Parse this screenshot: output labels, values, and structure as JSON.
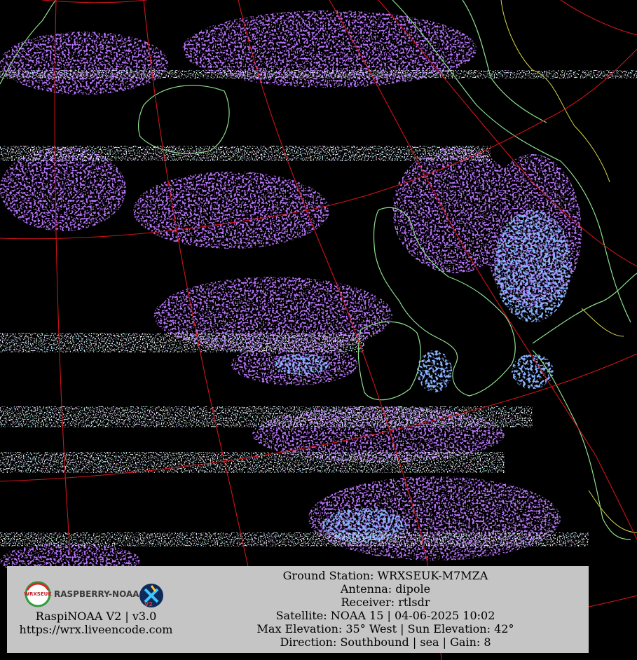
{
  "colors": {
    "background": "#000000",
    "cloud_primary": "#7a2ff0",
    "cloud_bright": "#3b74ff",
    "cloud_light": "#5fa8ff",
    "grid_line": "#d0141a",
    "coastline": "#8fe08f",
    "border_line": "#d8d64a",
    "panel_bg": "#c5c5c5"
  },
  "logo": {
    "badge_text": "WRXSEUK",
    "wordmark": "RASPBERRY-NOAA",
    "version_badge": "V2"
  },
  "left_info": {
    "version_line": "RaspiNOAA V2 | v3.0",
    "url_line": "https://wrx.liveencode.com"
  },
  "right_info": {
    "ground_station": "Ground Station: WRXSEUK-M7MZA",
    "antenna": "Antenna: dipole",
    "receiver": "Receiver: rtlsdr",
    "satellite": "Satellite: NOAA 15 | 04-06-2025 10:02",
    "elevation": "Max Elevation: 35° West | Sun Elevation: 42°",
    "direction": "Direction: Southbound | sea | Gain: 8"
  }
}
